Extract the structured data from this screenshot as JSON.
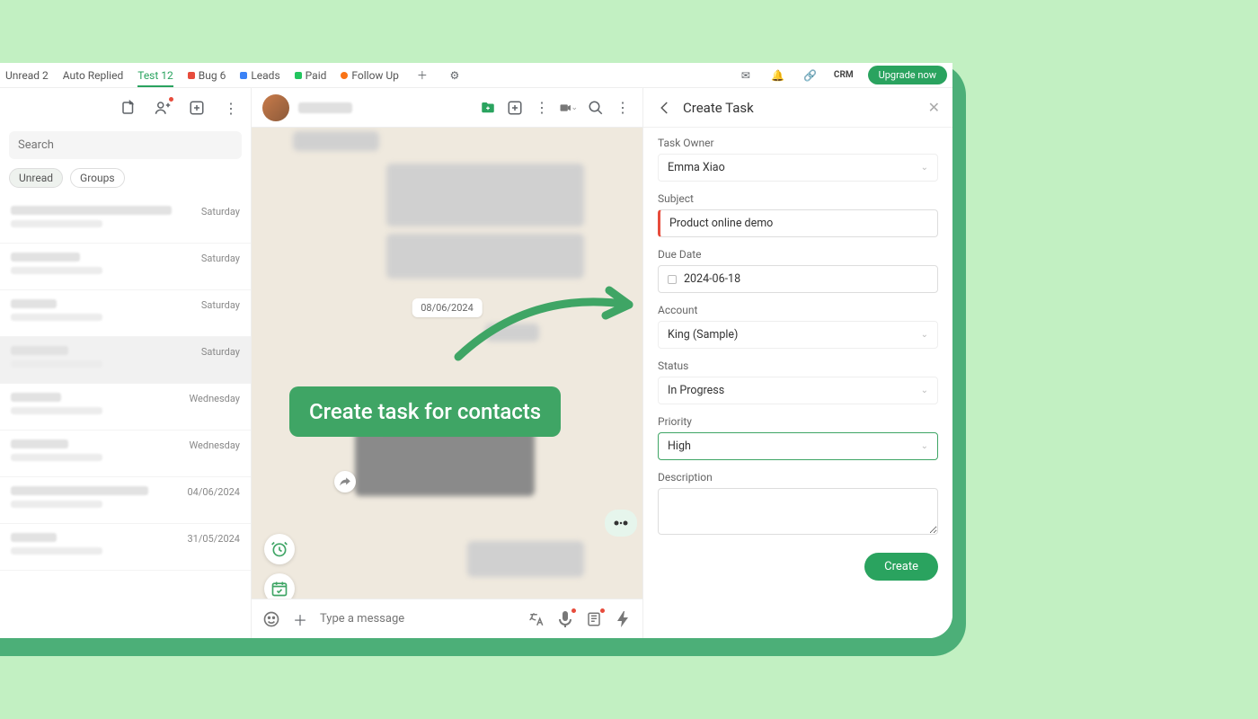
{
  "tabs": {
    "unread": "Unread 2",
    "autoReplied": "Auto Replied",
    "test": "Test 12",
    "bug": "Bug 6",
    "leads": "Leads",
    "paid": "Paid",
    "followUp": "Follow Up"
  },
  "header": {
    "crm": "CRM",
    "upgrade": "Upgrade now"
  },
  "search": {
    "placeholder": "Search"
  },
  "filters": {
    "unread": "Unread",
    "groups": "Groups"
  },
  "chats": [
    {
      "date": "Saturday"
    },
    {
      "date": "Saturday"
    },
    {
      "date": "Saturday"
    },
    {
      "date": "Saturday"
    },
    {
      "date": "Wednesday"
    },
    {
      "date": "Wednesday"
    },
    {
      "date": "04/06/2024"
    },
    {
      "date": "31/05/2024"
    }
  ],
  "conversation": {
    "datePill": "08/06/2024",
    "callout": "Create task for contacts",
    "messagePlaceholder": "Type a message"
  },
  "panel": {
    "title": "Create Task",
    "labels": {
      "owner": "Task Owner",
      "subject": "Subject",
      "dueDate": "Due Date",
      "account": "Account",
      "status": "Status",
      "priority": "Priority",
      "description": "Description"
    },
    "values": {
      "owner": "Emma Xiao",
      "subject": "Product online demo",
      "dueDate": "2024-06-18",
      "account": "King (Sample)",
      "status": "In Progress",
      "priority": "High"
    },
    "createBtn": "Create"
  }
}
